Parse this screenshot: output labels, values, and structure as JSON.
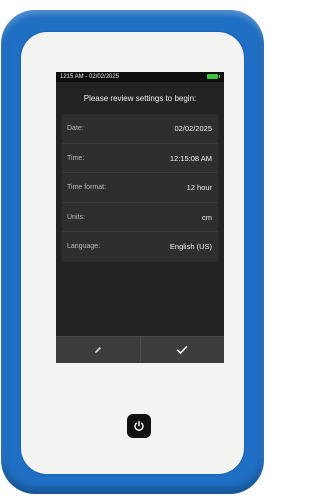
{
  "status": {
    "datetime": "1215 AM - 02/02/2025",
    "battery_color": "#3cc43c"
  },
  "prompt": "Please review settings to begin:",
  "settings": [
    {
      "label": "Date:",
      "value": "02/02/2025"
    },
    {
      "label": "Time:",
      "value": "12:15:08 AM"
    },
    {
      "label": "Time format:",
      "value": "12 hour"
    },
    {
      "label": "Units:",
      "value": "cm"
    },
    {
      "label": "Language:",
      "value": "English (US)"
    }
  ],
  "actions": {
    "edit_icon": "pencil-icon",
    "confirm_icon": "checkmark-icon"
  },
  "device": {
    "frame_color": "#1f6fc4",
    "power_icon": "power-icon"
  }
}
